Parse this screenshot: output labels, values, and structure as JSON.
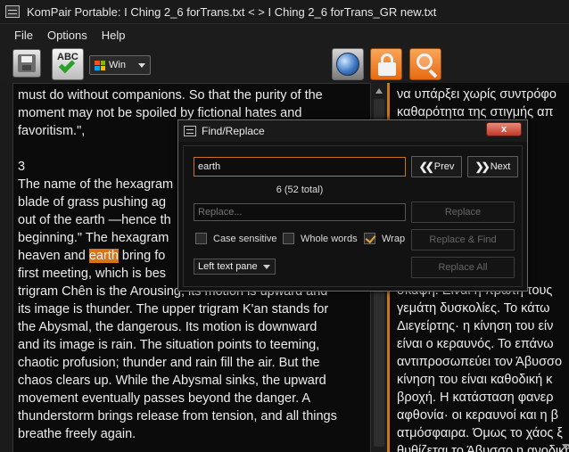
{
  "window": {
    "title": "KomPair Portable:  I Ching 2_6 forTrans.txt  < >  I Ching 2_6 forTrans_GR new.txt"
  },
  "menu": [
    "File",
    "Options",
    "Help"
  ],
  "toolbar": {
    "encoding": "Win",
    "icons": [
      "save-icon",
      "spellcheck-icon",
      "globe-icon",
      "lock-icon",
      "search-icon"
    ]
  },
  "left_pane": {
    "lines": [
      "must do without companions. So that the purity of the",
      "moment may not be spoiled by fictional hates and",
      "favoritism.\",",
      "",
      "3",
      "The name of the hexagram",
      "blade of grass pushing ag",
      "out of the earth —hence th",
      "beginning.\" The hexagram",
      "",
      "first meeting, which is bes",
      "trigram Chên is the Arousing; its motion is upward and",
      "its image is thunder. The upper trigram K'an stands for",
      "the Abysmal, the dangerous. Its motion is downward",
      "and its image is rain. The situation points to teeming,",
      "chaotic profusion; thunder and rain fill the air. But the",
      "chaos clears up. While the Abysmal sinks, the upward",
      "movement eventually passes beyond the danger. A",
      "thunderstorm brings release from tension, and all things",
      "breathe freely again."
    ],
    "highlight_line": {
      "before": "heaven and ",
      "match": "earth",
      "after": " bring fo"
    }
  },
  "right_pane": {
    "lines": [
      "να υπάρξει χωρίς συντρόφο",
      "καθαρότητα της στιγμής απ",
      "",
      "",
      "",
      "μου, Τ",
      "ίνει το",
      "το καθώ",
      "ημα τη",
      "τον τ",
      "υουν σ",
      "σκαψη. Είναι η πρώτη τους",
      "γεμάτη δυσκολίες. Το κάτω",
      "Διεγείρτης· η κίνηση του είν",
      "είναι ο κεραυνός. Το επάνω",
      "αντιπροσωπεύει τον Άβυσσο",
      "κίνηση του είναι καθοδική κ",
      "βροχή. Η κατάσταση φανερ",
      "αφθονία· οι κεραυνοί και η β",
      "ατμόσφαιρα. Όμως το χάος ξ",
      "θυθίζεται το Άβυσσο η ανοδική"
    ]
  },
  "dialog": {
    "title": "Find/Replace",
    "close_label": "x",
    "find_value": "earth",
    "count_text": "6 (52 total)",
    "replace_placeholder": "Replace...",
    "prev_label": "Prev",
    "next_label": "Next",
    "replace_label": "Replace",
    "replace_find_label": "Replace & Find",
    "replace_all_label": "Replace All",
    "case_sensitive_label": "Case sensitive",
    "whole_words_label": "Whole words",
    "wrap_label": "Wrap",
    "case_sensitive_checked": false,
    "whole_words_checked": false,
    "wrap_checked": true,
    "pane_option": "Left text pane"
  },
  "colors": {
    "accent": "#d8731a",
    "divider": "#c8761e",
    "background": "#0b0b0b"
  }
}
